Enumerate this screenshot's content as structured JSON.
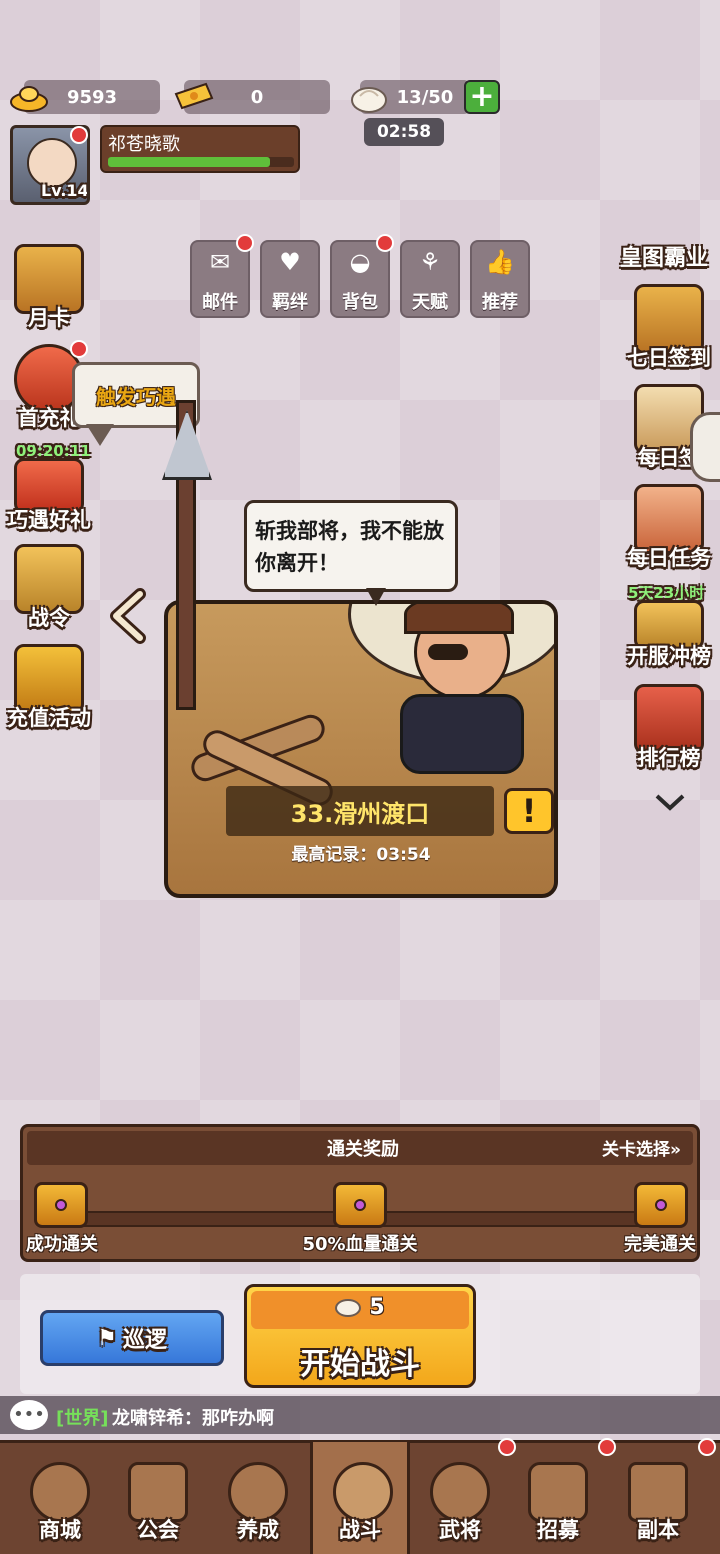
{
  "resources": {
    "gold": "9593",
    "tickets": "0",
    "stamina": "13/50",
    "stamina_timer": "02:58",
    "add_icon": "plus-icon"
  },
  "player": {
    "name": "祁苍晓歌",
    "level": "Lv.14",
    "exp_fraction": 0.87
  },
  "left_side": [
    {
      "label": "月卡",
      "color": "#d89a38"
    },
    {
      "label": "首充礼",
      "color": "#d9543c"
    },
    {
      "label": "巧遇好礼",
      "timer": "09:20:11",
      "color": "#e64a3a"
    },
    {
      "label": "战令",
      "color": "#c9953a"
    },
    {
      "label": "充值活动",
      "color": "#d9a13a"
    }
  ],
  "menu": [
    {
      "label": "邮件",
      "icon": "✉"
    },
    {
      "label": "羁绊",
      "icon": "♥"
    },
    {
      "label": "背包",
      "icon": "◒"
    },
    {
      "label": "天赋",
      "icon": "⚘"
    },
    {
      "label": "推荐",
      "icon": "👍"
    }
  ],
  "right_side": [
    {
      "label": "皇图霸业"
    },
    {
      "label": "七日签到",
      "color": "#c98a3a"
    },
    {
      "label": "每日签",
      "color": "#d9b06a"
    },
    {
      "label": "每日任务",
      "color": "#e08a5a"
    },
    {
      "label": "开服冲榜",
      "timer": "5天23小时",
      "color": "#c9953a"
    },
    {
      "label": "排行榜",
      "color": "#c9473a"
    }
  ],
  "tooltip": "触发巧遇",
  "stage": {
    "speech": "斩我部将，我不能放你离开！",
    "name": "33.滑州渡口",
    "record": "最高记录：03:54",
    "info_symbol": "!"
  },
  "rewards": {
    "title": "通关奖励",
    "select_label": "关卡选择",
    "select_arrow": "»",
    "milestones": [
      "成功通关",
      "50%血量通关",
      "完美通关"
    ]
  },
  "actions": {
    "patrol_label": "巡逻",
    "start_cost": "5",
    "start_label": "开始战斗"
  },
  "chat": {
    "channel": "[世界]",
    "message": "龙啸锌希：那咋办啊"
  },
  "nav": [
    {
      "label": "商城"
    },
    {
      "label": "公会"
    },
    {
      "label": "养成"
    },
    {
      "label": "战斗",
      "active": true
    },
    {
      "label": "武将"
    },
    {
      "label": "招募"
    },
    {
      "label": "副本"
    }
  ]
}
